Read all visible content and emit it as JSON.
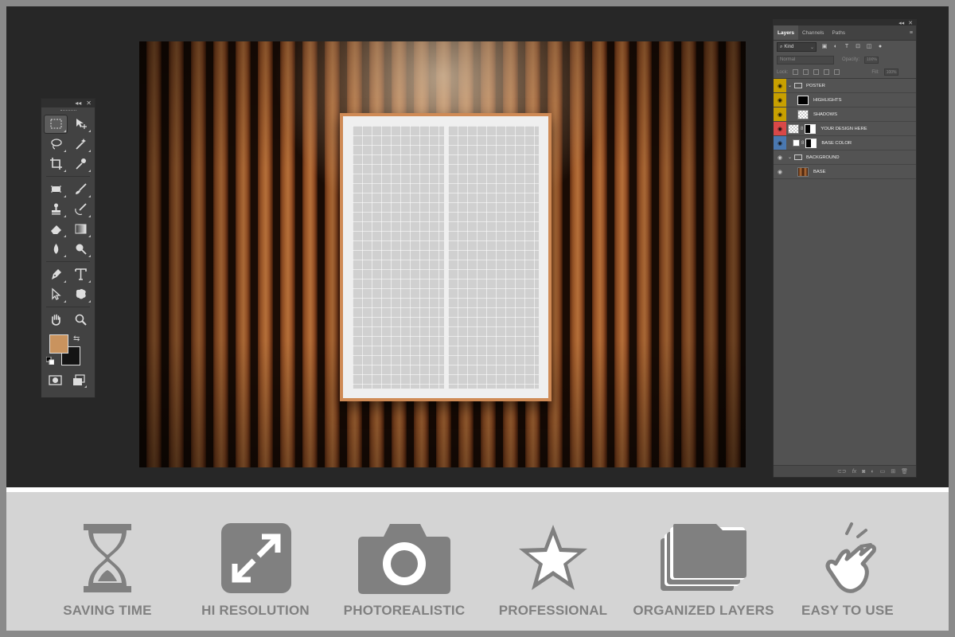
{
  "layers_panel": {
    "tabs": [
      "Layers",
      "Channels",
      "Paths"
    ],
    "filter_kind": "Kind",
    "blend_mode": "Normal",
    "opacity_label": "Opacity:",
    "opacity_value": "100%",
    "lock_label": "Lock:",
    "fill_label": "Fill:",
    "fill_value": "100%",
    "layers": [
      {
        "name": "POSTER",
        "type": "group",
        "tag_color": "#c8a000"
      },
      {
        "name": "HIGHLIGHTS",
        "type": "layer",
        "tag_color": "#c8a000"
      },
      {
        "name": "SHADOWS",
        "type": "layer",
        "tag_color": "#c8a000"
      },
      {
        "name": "YOUR DESIGN HERE",
        "type": "smart-object",
        "tag_color": "#d94848"
      },
      {
        "name": "BASE COLOR",
        "type": "fill",
        "tag_color": "#4a78b0"
      },
      {
        "name": "BACKGROUND",
        "type": "group",
        "tag_color": ""
      },
      {
        "name": "BASE",
        "type": "layer",
        "tag_color": ""
      }
    ]
  },
  "tools_panel": {
    "foreground_color": "#c9935e",
    "background_color": "#141414"
  },
  "features": [
    {
      "label": "SAVING TIME",
      "icon": "hourglass-icon"
    },
    {
      "label": "HI RESOLUTION",
      "icon": "expand-arrows-icon"
    },
    {
      "label": "PHOTOREALISTIC",
      "icon": "camera-icon"
    },
    {
      "label": "PROFESSIONAL",
      "icon": "star-icon"
    },
    {
      "label": "ORGANIZED LAYERS",
      "icon": "stacked-folders-icon"
    },
    {
      "label": "EASY TO USE",
      "icon": "tap-hand-icon"
    }
  ]
}
